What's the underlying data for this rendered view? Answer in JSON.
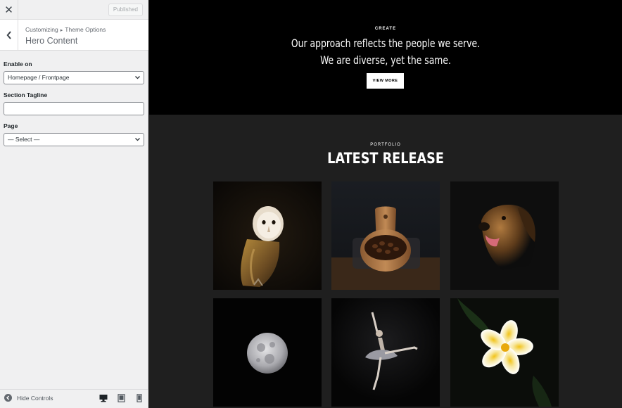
{
  "topbar": {
    "publish_label": "Published"
  },
  "section": {
    "breadcrumb_parent": "Customizing",
    "breadcrumb_child": "Theme Options",
    "title": "Hero Content"
  },
  "controls": {
    "enable_on": {
      "label": "Enable on",
      "value": "Homepage / Frontpage"
    },
    "tagline": {
      "label": "Section Tagline",
      "value": ""
    },
    "page": {
      "label": "Page",
      "value": "— Select —"
    }
  },
  "footer": {
    "hide_label": "Hide Controls"
  },
  "preview": {
    "hero": {
      "kicker": "CREATE",
      "title": "Our approach reflects the people we serve. We are diverse, yet the same.",
      "button": "VIEW MORE"
    },
    "portfolio": {
      "kicker": "PORTFOLIO",
      "title": "LATEST RELEASE",
      "tiles": [
        "owl-photo",
        "coffee-scoop-photo",
        "dog-photo",
        "moon-photo",
        "ballerina-photo",
        "frangipani-photo"
      ]
    }
  },
  "colors": {
    "sidebar_bg": "#f0f0f1",
    "hero_bg": "#000000",
    "portfolio_bg": "#1f1f1f"
  }
}
